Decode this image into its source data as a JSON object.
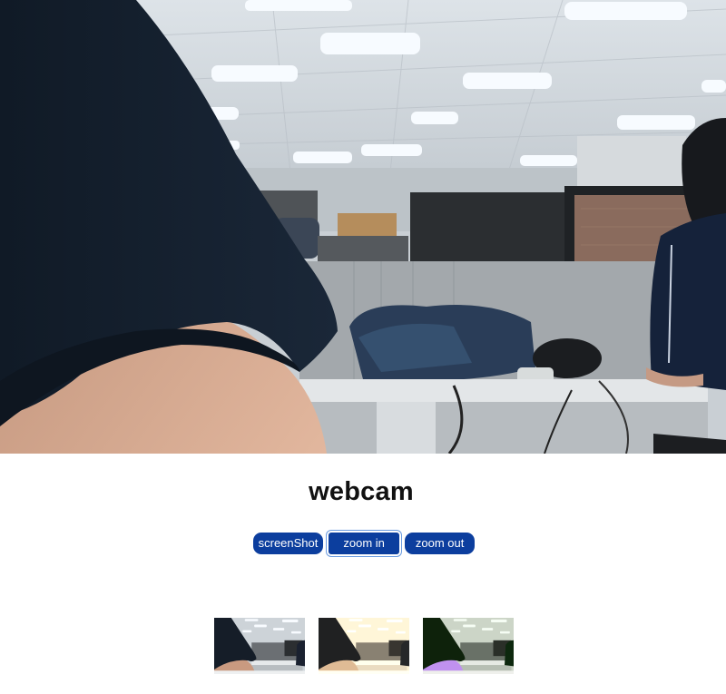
{
  "page": {
    "title": "webcam"
  },
  "controls": {
    "buttons": [
      {
        "id": "screenshot",
        "label": "screenShot"
      },
      {
        "id": "zoom-in",
        "label": "zoom in"
      },
      {
        "id": "zoom-out",
        "label": "zoom out"
      }
    ]
  },
  "thumbnails": [
    {
      "filter": "normal"
    },
    {
      "filter": "sepia"
    },
    {
      "filter": "purple"
    }
  ]
}
